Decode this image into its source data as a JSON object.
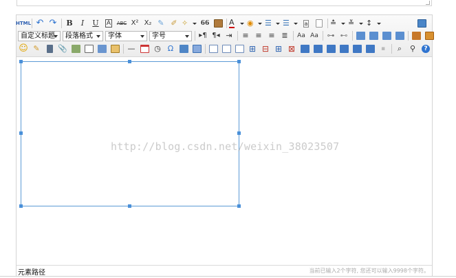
{
  "top_label": "",
  "toolbar": {
    "source_label": "HTML",
    "bold_label": "B",
    "italic_label": "I",
    "underline_label": "U",
    "border_label": "A",
    "strike_label": "ABC",
    "superscript_label": "X²",
    "subscript_label": "X₂",
    "quote_label": "66",
    "font_color_label": "A",
    "paragraph_format_selects": {
      "custom_title": "自定义标题",
      "paragraph": "段落格式",
      "font_family": "字体",
      "font_size": "字号"
    },
    "clear_label": "Aa",
    "omega_label": "Ω",
    "hr_label": "—"
  },
  "canvas": {
    "watermark": "http://blog.csdn.net/weixin_38023507"
  },
  "statusbar": {
    "element_path": "元素路径",
    "word_count": "当前已输入2个字符, 您还可以输入9998个字符。"
  },
  "colors": {
    "frame_border": "#5b9ad5",
    "handle": "#4a90d9",
    "help_icon": "#2f74d0"
  }
}
